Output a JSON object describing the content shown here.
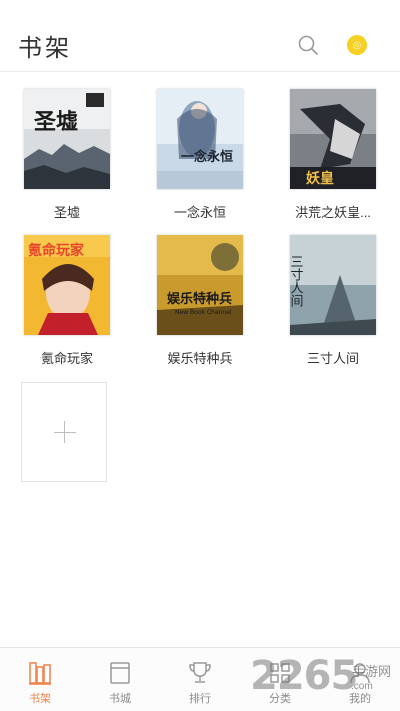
{
  "header": {
    "title": "书架",
    "search_icon": "search-icon",
    "coin_icon": "coin-icon",
    "coin_symbol": "◎"
  },
  "books": [
    {
      "title": "圣墟",
      "cover_text": "圣墟"
    },
    {
      "title": "一念永恒",
      "cover_text": "一念永恒"
    },
    {
      "title": "洪荒之妖皇...",
      "cover_text": "妖皇"
    },
    {
      "title": "氪命玩家",
      "cover_text": "氪命玩家"
    },
    {
      "title": "娱乐特种兵",
      "cover_text": "娱乐特种兵",
      "cover_subtext": "New Book Channel"
    },
    {
      "title": "三寸人间",
      "cover_text": "三寸人间"
    }
  ],
  "add_book_icon": "plus-icon",
  "tabs": [
    {
      "label": "书架",
      "icon": "bookshelf-icon",
      "active": true
    },
    {
      "label": "书城",
      "icon": "bookstore-icon",
      "active": false
    },
    {
      "label": "排行",
      "icon": "trophy-icon",
      "active": false
    },
    {
      "label": "分类",
      "icon": "category-icon",
      "active": false
    },
    {
      "label": "我的",
      "icon": "profile-icon",
      "active": false
    }
  ],
  "watermark": {
    "number": "2265",
    "site": "手游网",
    "domain": ".com"
  },
  "colors": {
    "accent": "#f0824a",
    "coin": "#f6d022",
    "text": "#333333",
    "muted": "#8a8a8a"
  }
}
